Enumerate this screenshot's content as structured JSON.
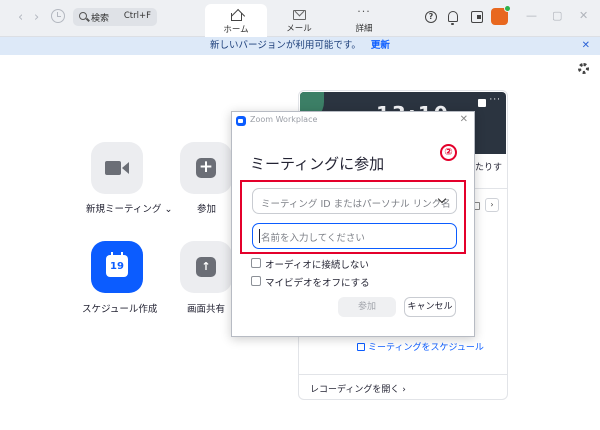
{
  "titlebar": {
    "back_arrow": "‹",
    "forward_arrow": "›",
    "search_label": "検索",
    "search_shortcut": "Ctrl+F",
    "tabs": [
      {
        "label": "ホーム",
        "icon": "home-icon"
      },
      {
        "label": "メール",
        "icon": "mail-icon"
      },
      {
        "label": "詳細",
        "icon": "more-icon"
      }
    ],
    "more_glyph": "···",
    "help_glyph": "?",
    "window_controls": {
      "minimize": "—",
      "maximize": "▢",
      "close": "✕"
    }
  },
  "notice": {
    "text": "新しいバージョンが利用可能です。",
    "link": "更新",
    "close": "✕"
  },
  "home_actions": [
    {
      "label": "新規ミーティング ⌄",
      "icon": "video-camera-icon"
    },
    {
      "label": "参加",
      "icon": "plus-icon",
      "glyph": "+"
    },
    {
      "label": "スケジュール作成",
      "icon": "calendar-icon",
      "glyph": "19"
    },
    {
      "label": "画面共有",
      "icon": "share-screen-icon",
      "glyph": "↑"
    }
  ],
  "calendar_panel": {
    "time_partial": "13:10",
    "peek_text": "たりす",
    "next_glyph": "›",
    "schedule_link": "ミーティングをスケジュール",
    "recording_link": "レコーディングを開く ›"
  },
  "dialog": {
    "window_title": "Zoom Workplace",
    "close": "✕",
    "heading": "ミーティングに参加",
    "meeting_id_placeholder": "ミーティング ID またはパーソナル リンク名",
    "name_placeholder": "名前を入力してください",
    "options": [
      {
        "label": "オーディオに接続しない",
        "checked": false
      },
      {
        "label": "マイビデオをオフにする",
        "checked": false
      }
    ],
    "join_button": "参加",
    "cancel_button": "キャンセル"
  },
  "annotation": {
    "step_mark": "②",
    "highlight_color": "#e4002b"
  },
  "colors": {
    "accent": "#0b5cff",
    "avatar": "#e8681f",
    "presence": "#2fb24c"
  }
}
